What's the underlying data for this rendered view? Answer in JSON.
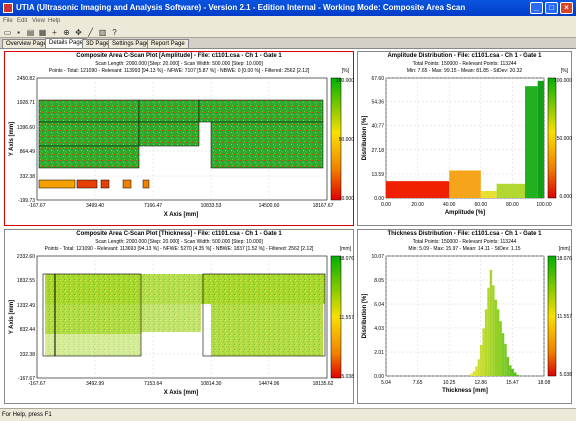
{
  "window": {
    "title": "UTIA (Ultrasonic Imaging and Analysis Software) - Version 2.1 - Edition Internal - Working Mode: Composite Area Scan"
  },
  "menu": [
    "File",
    "Edit",
    "View",
    "Help"
  ],
  "tabs": [
    {
      "label": "Overview Page",
      "active": false
    },
    {
      "label": "Details Page",
      "active": true
    },
    {
      "label": "3D Page",
      "active": false
    },
    {
      "label": "Settings Page",
      "active": false
    },
    {
      "label": "Report Page",
      "active": false
    }
  ],
  "panels": {
    "amp_cscan": {
      "title": "Composite Area C-Scan Plot [Amplitude] - File: c1101.csa - Ch 1 - Gate 1",
      "line1": "Scan Length: 2000.000 [Step: 20.000] - Scan Width: 500.000 [Step: 10.000]",
      "line2": "Points - Total: 121090 - Relevant: 113993 [94.13 %] - NFWE: 7107 [5.87 %] - NBWE: 0 [0.00 %] - Filtered: 2562 [2.12]",
      "ylabel": "Y Axis [mm]",
      "xlabel": "X Axis [mm]",
      "yticks": [
        "2450.82",
        "1928.71",
        "1396.60",
        "864.49",
        "332.38",
        "-199.73"
      ],
      "xticks": [
        "-167.67",
        "3499.40",
        "7166.47",
        "10833.53",
        "14500.60",
        "18167.67"
      ],
      "scale_unit": "[%]",
      "scale_ticks": [
        "100.000",
        "50.000",
        "0.000"
      ]
    },
    "amp_dist": {
      "title": "Amplitude Distribution - File: c1101.csa - Ch 1 - Gate 1",
      "line1": "Total Points: 150000 - Relevant Points: 113244",
      "line2": "Min: 7.65 - Max: 99.15 - Mean: 81.85 - StDev: 20.32",
      "ylabel": "Distribution [%]",
      "xlabel": "Amplitude [%]",
      "scale_unit": "[%]",
      "scale_ticks": [
        "100.000",
        "50.000",
        "0.000"
      ]
    },
    "thk_cscan": {
      "title": "Composite Area C-Scan Plot [Thickness] - File: c1101.csa - Ch 1 - Gate 1",
      "line1": "Scan Length: 2000.000 [Step: 20.000] - Scan Width: 500.000 [Step: 10.000]",
      "line2": "Points - Total: 121090 - Relevant: 113693 [94.13 %] - NFWE: 5270 [4.35 %] - NBWE: 1837 [1.52 %] - Filtered: 2562 [2.12]",
      "ylabel": "Y Axis [mm]",
      "xlabel": "X Axis [mm]",
      "yticks": [
        "2332.60",
        "1832.55",
        "1332.49",
        "832.44",
        "332.38",
        "-167.67"
      ],
      "xticks": [
        "-167.67",
        "3492.99",
        "7153.64",
        "10814.30",
        "14474.96",
        "18135.62"
      ],
      "scale_unit": "[mm]",
      "scale_ticks": [
        "18.076",
        "11.557",
        "5.038"
      ]
    },
    "thk_dist": {
      "title": "Thickness Distribution - File: c1101.csa - Ch 1 - Gate 1",
      "line1": "Total Points: 150000 - Relevant Points: 113244",
      "line2": "Min: 5.09 - Max: 15.97 - Mean: 14.11 - StDev: 1.15",
      "ylabel": "Distribution [%]",
      "xlabel": "Thickness [mm]",
      "scale_unit": "[mm]",
      "scale_ticks": [
        "18.076",
        "11.557",
        "5.038"
      ]
    }
  },
  "chart_data": [
    {
      "type": "bar",
      "name": "amplitude_distribution",
      "title": "Amplitude Distribution - File: c1101.csa - Ch 1 - Gate 1",
      "xlabel": "Amplitude [%]",
      "ylabel": "Distribution [%]",
      "xlim": [
        0,
        100
      ],
      "ylim": [
        0,
        67.6
      ],
      "yticks": [
        0.0,
        13.59,
        27.18,
        40.77,
        54.36,
        67.6
      ],
      "xticks": [
        0.0,
        20.0,
        40.0,
        60.0,
        80.0,
        100.0
      ],
      "bins": [
        {
          "x0": 0,
          "x1": 40,
          "value": 9.5,
          "color": "#ee2000"
        },
        {
          "x0": 40,
          "x1": 60,
          "value": 15.5,
          "color": "#f6a51a"
        },
        {
          "x0": 60,
          "x1": 70,
          "value": 4.0,
          "color": "#e8e030"
        },
        {
          "x0": 70,
          "x1": 88,
          "value": 8.0,
          "color": "#b0d830"
        },
        {
          "x0": 88,
          "x1": 96,
          "value": 63.0,
          "color": "#20b020"
        },
        {
          "x0": 96,
          "x1": 100,
          "value": 66.0,
          "color": "#14a014"
        }
      ]
    },
    {
      "type": "bar",
      "name": "thickness_distribution",
      "title": "Thickness Distribution - File: c1101.csa - Ch 1 - Gate 1",
      "xlabel": "Thickness [mm]",
      "ylabel": "Distribution [%]",
      "xlim": [
        5.04,
        18.08
      ],
      "ylim": [
        0,
        10.07
      ],
      "yticks": [
        0.0,
        2.01,
        4.03,
        6.04,
        8.05,
        10.07
      ],
      "xticks": [
        5.04,
        7.65,
        10.25,
        12.86,
        15.47,
        18.08
      ],
      "x": [
        12.0,
        12.2,
        12.4,
        12.6,
        12.8,
        13.0,
        13.2,
        13.4,
        13.6,
        13.8,
        14.0,
        14.2,
        14.4,
        14.6,
        14.8,
        15.0,
        15.2,
        15.4,
        15.6,
        15.8
      ],
      "values": [
        0.2,
        0.4,
        0.8,
        1.4,
        2.6,
        4.0,
        5.6,
        7.4,
        8.9,
        7.6,
        6.4,
        5.6,
        4.6,
        3.6,
        2.7,
        1.6,
        0.9,
        0.6,
        0.3,
        0.1
      ]
    }
  ],
  "status": {
    "text": "For Help, press F1"
  }
}
